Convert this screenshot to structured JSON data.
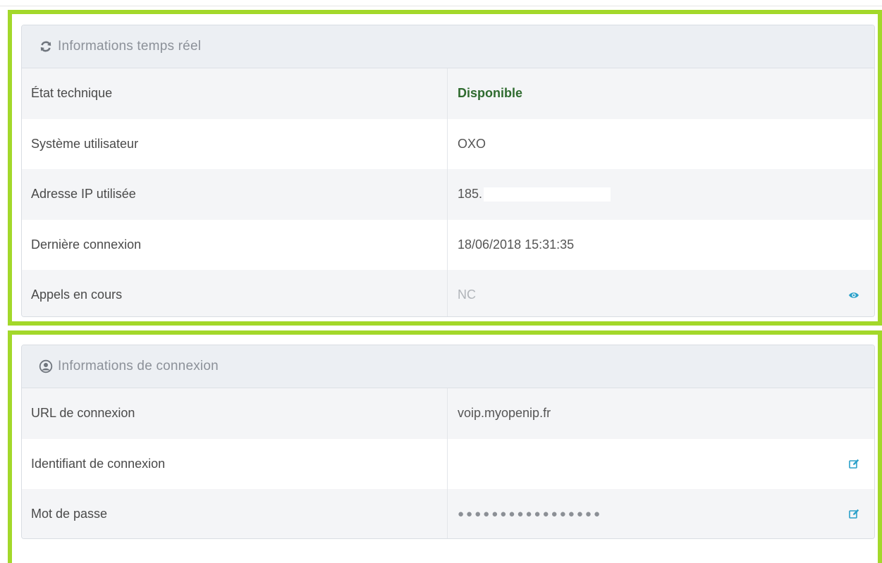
{
  "panels": [
    {
      "title": "Informations temps réel",
      "icon": "refresh-icon",
      "rows": [
        {
          "label": "État technique",
          "value": "Disponible"
        },
        {
          "label": "Système utilisateur",
          "value": "OXO"
        },
        {
          "label": "Adresse IP utilisée",
          "value": "185."
        },
        {
          "label": "Dernière connexion",
          "value": "18/06/2018 15:31:35"
        },
        {
          "label": "Appels en cours",
          "value": "NC",
          "action_icon": "eye-icon"
        }
      ]
    },
    {
      "title": "Informations de connexion",
      "icon": "user-circle-icon",
      "rows": [
        {
          "label": "URL de connexion",
          "value": "voip.myopenip.fr"
        },
        {
          "label": "Identifiant de connexion",
          "value": "",
          "action_icon": "edit-icon"
        },
        {
          "label": "Mot de passe",
          "value": "●●●●●●●●●●●●●●●●●",
          "action_icon": "edit-icon"
        }
      ]
    }
  ],
  "colors": {
    "highlight": "#a3d82a",
    "status_available": "#2f6b2f",
    "action_icon": "#2aa0c9",
    "header_bg": "#eceff3"
  }
}
